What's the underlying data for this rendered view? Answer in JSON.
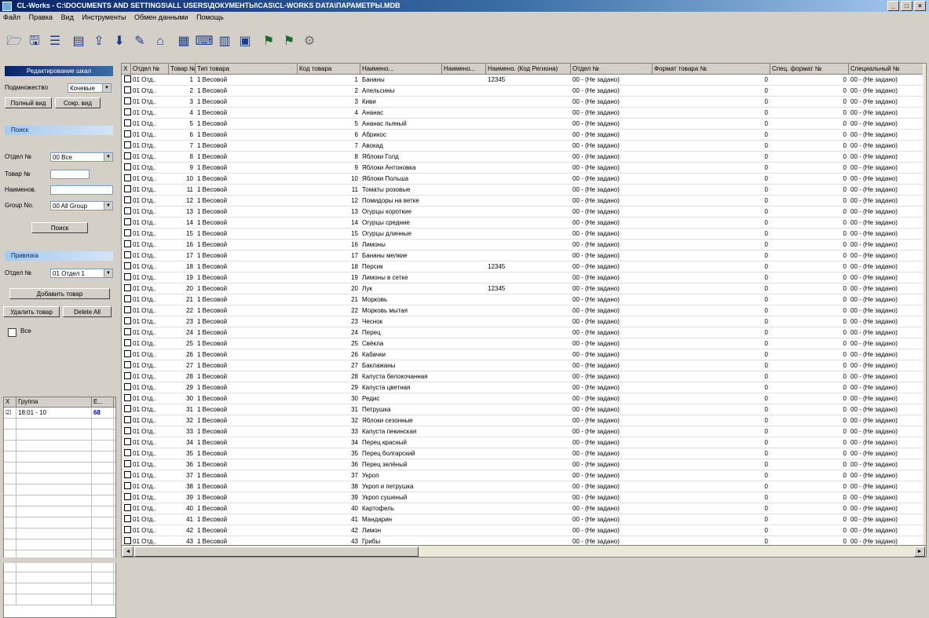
{
  "window": {
    "title": "CL-Works - C:\\DOCUMENTS AND SETTINGS\\ALL USERS\\ДОКУМЕНТЫ\\CAS\\CL-WORKS DATA\\ПАРАМЕТРЫ.MDB",
    "minimize": "_",
    "maximize": "□",
    "close": "×"
  },
  "menu": [
    "Файл",
    "Правка",
    "Вид",
    "Инструменты",
    "Обмен данными",
    "Помощь"
  ],
  "toolbar": {
    "icons": [
      "open-icon",
      "save-icon",
      "list-icon",
      "scale-icon",
      "upload-icon",
      "download-icon",
      "edit-icon",
      "home-icon",
      "print-icon",
      "keyboard-icon",
      "table-icon",
      "window-icon",
      "flag-icon",
      "flag2-icon",
      "settings-icon"
    ]
  },
  "left_panel": {
    "header": "Редактирование шкал",
    "view_label": "Подмножество",
    "view_value": "Кочевые",
    "full_view_btn": "Полный вид",
    "short_view_btn": "Сокр. вид",
    "search_group": "Поиск",
    "dept_label": "Отдел №",
    "dept_value": "00 Все",
    "item_label": "Товар №",
    "item_value": "",
    "name_label": "Наименов.",
    "name_value": "",
    "group_label": "Group No.",
    "group_value": "00 All Group",
    "search_btn": "Поиск",
    "link_group": "Привязка",
    "link_dept_label": "Отдел №",
    "link_dept_value": "01 Отдел 1",
    "add_item_btn": "Добавить товар",
    "delete_item_btn": "Удалить товар",
    "delete_all_btn": "Delete All",
    "all_checkbox_label": "Все",
    "mini_grid": {
      "headers": [
        "X",
        "Группа",
        "Е..."
      ],
      "rows": [
        {
          "check": "☑",
          "group": "18:01 - 10",
          "e": "68"
        }
      ]
    }
  },
  "grid": {
    "headers": [
      "X",
      "Отдел №",
      "Товар №",
      "Тип товара",
      "Код товара",
      "Наимено...",
      "Наимено...",
      "Наимено. (Код Региона)",
      "Отдел №",
      "Формат товара №",
      "Спец. формат №",
      "Специальный №"
    ],
    "rows": [
      {
        "dept": "01 Отд..",
        "item": "1",
        "type": "1 Весовой",
        "code": "1",
        "name": "Бананы",
        "name2": "",
        "region": "12345",
        "dept2": "00 - (Не задано)",
        "fmt": "0",
        "spec": "0",
        "special": "00 - (Не задано)"
      },
      {
        "dept": "01 Отд..",
        "item": "2",
        "type": "1 Весовой",
        "code": "2",
        "name": "Апельсины",
        "name2": "",
        "region": "",
        "dept2": "00 - (Не задано)",
        "fmt": "0",
        "spec": "0",
        "special": "00 - (Не задано)"
      },
      {
        "dept": "01 Отд..",
        "item": "3",
        "type": "1 Весовой",
        "code": "3",
        "name": "Киви",
        "name2": "",
        "region": "",
        "dept2": "00 - (Не задано)",
        "fmt": "0",
        "spec": "0",
        "special": "00 - (Не задано)"
      },
      {
        "dept": "01 Отд..",
        "item": "4",
        "type": "1 Весовой",
        "code": "4",
        "name": "Ананас",
        "name2": "",
        "region": "",
        "dept2": "00 - (Не задано)",
        "fmt": "0",
        "spec": "0",
        "special": "00 - (Не задано)"
      },
      {
        "dept": "01 Отд..",
        "item": "5",
        "type": "1 Весовой",
        "code": "5",
        "name": "Ананас пьяный",
        "name2": "",
        "region": "",
        "dept2": "00 - (Не задано)",
        "fmt": "0",
        "spec": "0",
        "special": "00 - (Не задано)"
      },
      {
        "dept": "01 Отд..",
        "item": "6",
        "type": "1 Весовой",
        "code": "6",
        "name": "Абрикос",
        "name2": "",
        "region": "",
        "dept2": "00 - (Не задано)",
        "fmt": "0",
        "spec": "0",
        "special": "00 - (Не задано)"
      },
      {
        "dept": "01 Отд..",
        "item": "7",
        "type": "1 Весовой",
        "code": "7",
        "name": "Авокад",
        "name2": "",
        "region": "",
        "dept2": "00 - (Не задано)",
        "fmt": "0",
        "spec": "0",
        "special": "00 - (Не задано)"
      },
      {
        "dept": "01 Отд..",
        "item": "8",
        "type": "1 Весовой",
        "code": "8",
        "name": "Яблоки Голд",
        "name2": "",
        "region": "",
        "dept2": "00 - (Не задано)",
        "fmt": "0",
        "spec": "0",
        "special": "00 - (Не задано)"
      },
      {
        "dept": "01 Отд..",
        "item": "9",
        "type": "1 Весовой",
        "code": "9",
        "name": "Яблоки Антоновка",
        "name2": "",
        "region": "",
        "dept2": "00 - (Не задано)",
        "fmt": "0",
        "spec": "0",
        "special": "00 - (Не задано)"
      },
      {
        "dept": "01 Отд..",
        "item": "10",
        "type": "1 Весовой",
        "code": "10",
        "name": "Яблоки Польша",
        "name2": "",
        "region": "",
        "dept2": "00 - (Не задано)",
        "fmt": "0",
        "spec": "0",
        "special": "00 - (Не задано)"
      },
      {
        "dept": "01 Отд..",
        "item": "11",
        "type": "1 Весовой",
        "code": "11",
        "name": "Томаты розовые",
        "name2": "",
        "region": "",
        "dept2": "00 - (Не задано)",
        "fmt": "0",
        "spec": "0",
        "special": "00 - (Не задано)"
      },
      {
        "dept": "01 Отд..",
        "item": "12",
        "type": "1 Весовой",
        "code": "12",
        "name": "Помидоры на ветке",
        "name2": "",
        "region": "",
        "dept2": "00 - (Не задано)",
        "fmt": "0",
        "spec": "0",
        "special": "00 - (Не задано)"
      },
      {
        "dept": "01 Отд..",
        "item": "13",
        "type": "1 Весовой",
        "code": "13",
        "name": "Огурцы короткие",
        "name2": "",
        "region": "",
        "dept2": "00 - (Не задано)",
        "fmt": "0",
        "spec": "0",
        "special": "00 - (Не задано)"
      },
      {
        "dept": "01 Отд..",
        "item": "14",
        "type": "1 Весовой",
        "code": "14",
        "name": "Огурцы средние",
        "name2": "",
        "region": "",
        "dept2": "00 - (Не задано)",
        "fmt": "0",
        "spec": "0",
        "special": "00 - (Не задано)"
      },
      {
        "dept": "01 Отд..",
        "item": "15",
        "type": "1 Весовой",
        "code": "15",
        "name": "Огурцы длинные",
        "name2": "",
        "region": "",
        "dept2": "00 - (Не задано)",
        "fmt": "0",
        "spec": "0",
        "special": "00 - (Не задано)"
      },
      {
        "dept": "01 Отд..",
        "item": "16",
        "type": "1 Весовой",
        "code": "16",
        "name": "Лимоны",
        "name2": "",
        "region": "",
        "dept2": "00 - (Не задано)",
        "fmt": "0",
        "spec": "0",
        "special": "00 - (Не задано)"
      },
      {
        "dept": "01 Отд..",
        "item": "17",
        "type": "1 Весовой",
        "code": "17",
        "name": "Бананы мелкие",
        "name2": "",
        "region": "",
        "dept2": "00 - (Не задано)",
        "fmt": "0",
        "spec": "0",
        "special": "00 - (Не задано)"
      },
      {
        "dept": "01 Отд..",
        "item": "18",
        "type": "1 Весовой",
        "code": "18",
        "name": "Персик",
        "name2": "",
        "region": "12345",
        "dept2": "00 - (Не задано)",
        "fmt": "0",
        "spec": "0",
        "special": "00 - (Не задано)"
      },
      {
        "dept": "01 Отд..",
        "item": "19",
        "type": "1 Весовой",
        "code": "19",
        "name": "Лимоны в сетке",
        "name2": "",
        "region": "",
        "dept2": "00 - (Не задано)",
        "fmt": "0",
        "spec": "0",
        "special": "00 - (Не задано)"
      },
      {
        "dept": "01 Отд..",
        "item": "20",
        "type": "1 Весовой",
        "code": "20",
        "name": "Лук",
        "name2": "",
        "region": "12345",
        "dept2": "00 - (Не задано)",
        "fmt": "0",
        "spec": "0",
        "special": "00 - (Не задано)"
      },
      {
        "dept": "01 Отд..",
        "item": "21",
        "type": "1 Весовой",
        "code": "21",
        "name": "Морковь",
        "name2": "",
        "region": "",
        "dept2": "00 - (Не задано)",
        "fmt": "0",
        "spec": "0",
        "special": "00 - (Не задано)"
      },
      {
        "dept": "01 Отд..",
        "item": "22",
        "type": "1 Весовой",
        "code": "22",
        "name": "Морковь мытая",
        "name2": "",
        "region": "",
        "dept2": "00 - (Не задано)",
        "fmt": "0",
        "spec": "0",
        "special": "00 - (Не задано)"
      },
      {
        "dept": "01 Отд..",
        "item": "23",
        "type": "1 Весовой",
        "code": "23",
        "name": "Чеснок",
        "name2": "",
        "region": "",
        "dept2": "00 - (Не задано)",
        "fmt": "0",
        "spec": "0",
        "special": "00 - (Не задано)"
      },
      {
        "dept": "01 Отд..",
        "item": "24",
        "type": "1 Весовой",
        "code": "24",
        "name": "Перец",
        "name2": "",
        "region": "",
        "dept2": "00 - (Не задано)",
        "fmt": "0",
        "spec": "0",
        "special": "00 - (Не задано)"
      },
      {
        "dept": "01 Отд..",
        "item": "25",
        "type": "1 Весовой",
        "code": "25",
        "name": "Свёкла",
        "name2": "",
        "region": "",
        "dept2": "00 - (Не задано)",
        "fmt": "0",
        "spec": "0",
        "special": "00 - (Не задано)"
      },
      {
        "dept": "01 Отд..",
        "item": "26",
        "type": "1 Весовой",
        "code": "26",
        "name": "Кабачки",
        "name2": "",
        "region": "",
        "dept2": "00 - (Не задано)",
        "fmt": "0",
        "spec": "0",
        "special": "00 - (Не задано)"
      },
      {
        "dept": "01 Отд..",
        "item": "27",
        "type": "1 Весовой",
        "code": "27",
        "name": "Баклажаны",
        "name2": "",
        "region": "",
        "dept2": "00 - (Не задано)",
        "fmt": "0",
        "spec": "0",
        "special": "00 - (Не задано)"
      },
      {
        "dept": "01 Отд..",
        "item": "28",
        "type": "1 Весовой",
        "code": "28",
        "name": "Капуста белокочанная",
        "name2": "",
        "region": "",
        "dept2": "00 - (Не задано)",
        "fmt": "0",
        "spec": "0",
        "special": "00 - (Не задано)"
      },
      {
        "dept": "01 Отд..",
        "item": "29",
        "type": "1 Весовой",
        "code": "29",
        "name": "Капуста цветная",
        "name2": "",
        "region": "",
        "dept2": "00 - (Не задано)",
        "fmt": "0",
        "spec": "0",
        "special": "00 - (Не задано)"
      },
      {
        "dept": "01 Отд..",
        "item": "30",
        "type": "1 Весовой",
        "code": "30",
        "name": "Редис",
        "name2": "",
        "region": "",
        "dept2": "00 - (Не задано)",
        "fmt": "0",
        "spec": "0",
        "special": "00 - (Не задано)"
      },
      {
        "dept": "01 Отд..",
        "item": "31",
        "type": "1 Весовой",
        "code": "31",
        "name": "Петрушка",
        "name2": "",
        "region": "",
        "dept2": "00 - (Не задано)",
        "fmt": "0",
        "spec": "0",
        "special": "00 - (Не задано)"
      },
      {
        "dept": "01 Отд..",
        "item": "32",
        "type": "1 Весовой",
        "code": "32",
        "name": "Яблоки сезонные",
        "name2": "",
        "region": "",
        "dept2": "00 - (Не задано)",
        "fmt": "0",
        "spec": "0",
        "special": "00 - (Не задано)"
      },
      {
        "dept": "01 Отд..",
        "item": "33",
        "type": "1 Весовой",
        "code": "33",
        "name": "Капуста пекинская",
        "name2": "",
        "region": "",
        "dept2": "00 - (Не задано)",
        "fmt": "0",
        "spec": "0",
        "special": "00 - (Не задано)"
      },
      {
        "dept": "01 Отд..",
        "item": "34",
        "type": "1 Весовой",
        "code": "34",
        "name": "Перец красный",
        "name2": "",
        "region": "",
        "dept2": "00 - (Не задано)",
        "fmt": "0",
        "spec": "0",
        "special": "00 - (Не задано)"
      },
      {
        "dept": "01 Отд..",
        "item": "35",
        "type": "1 Весовой",
        "code": "35",
        "name": "Перец болгарский",
        "name2": "",
        "region": "",
        "dept2": "00 - (Не задано)",
        "fmt": "0",
        "spec": "0",
        "special": "00 - (Не задано)"
      },
      {
        "dept": "01 Отд..",
        "item": "36",
        "type": "1 Весовой",
        "code": "36",
        "name": "Перец зелёный",
        "name2": "",
        "region": "",
        "dept2": "00 - (Не задано)",
        "fmt": "0",
        "spec": "0",
        "special": "00 - (Не задано)"
      },
      {
        "dept": "01 Отд..",
        "item": "37",
        "type": "1 Весовой",
        "code": "37",
        "name": "Укроп",
        "name2": "",
        "region": "",
        "dept2": "00 - (Не задано)",
        "fmt": "0",
        "spec": "0",
        "special": "00 - (Не задано)"
      },
      {
        "dept": "01 Отд..",
        "item": "38",
        "type": "1 Весовой",
        "code": "38",
        "name": "Укроп и петрушка",
        "name2": "",
        "region": "",
        "dept2": "00 - (Не задано)",
        "fmt": "0",
        "spec": "0",
        "special": "00 - (Не задано)"
      },
      {
        "dept": "01 Отд..",
        "item": "39",
        "type": "1 Весовой",
        "code": "39",
        "name": "Укроп сушеный",
        "name2": "",
        "region": "",
        "dept2": "00 - (Не задано)",
        "fmt": "0",
        "spec": "0",
        "special": "00 - (Не задано)"
      },
      {
        "dept": "01 Отд..",
        "item": "40",
        "type": "1 Весовой",
        "code": "40",
        "name": "Картофель",
        "name2": "",
        "region": "",
        "dept2": "00 - (Не задано)",
        "fmt": "0",
        "spec": "0",
        "special": "00 - (Не задано)"
      },
      {
        "dept": "01 Отд..",
        "item": "41",
        "type": "1 Весовой",
        "code": "41",
        "name": "Мандарин",
        "name2": "",
        "region": "",
        "dept2": "00 - (Не задано)",
        "fmt": "0",
        "spec": "0",
        "special": "00 - (Не задано)"
      },
      {
        "dept": "01 Отд..",
        "item": "42",
        "type": "1 Весовой",
        "code": "42",
        "name": "Лимон",
        "name2": "",
        "region": "",
        "dept2": "00 - (Не задано)",
        "fmt": "0",
        "spec": "0",
        "special": "00 - (Не задано)"
      },
      {
        "dept": "01 Отд..",
        "item": "43",
        "type": "1 Весовой",
        "code": "43",
        "name": "Грибы",
        "name2": "",
        "region": "",
        "dept2": "00 - (Не задано)",
        "fmt": "0",
        "spec": "0",
        "special": "00 - (Не задано)"
      }
    ]
  },
  "scroll": {
    "left": "◄",
    "right": "►"
  }
}
